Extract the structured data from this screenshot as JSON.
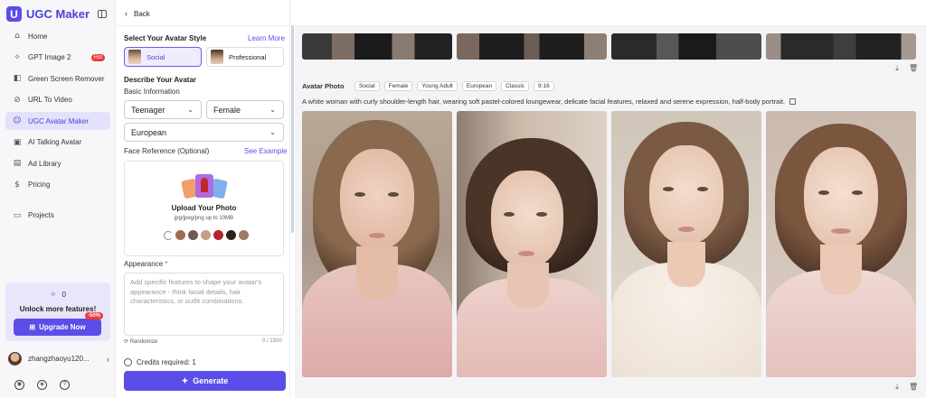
{
  "app": {
    "logo_letter": "U",
    "name": "UGC Maker"
  },
  "sidebar": {
    "items": [
      {
        "label": "Home",
        "icon": "home-icon",
        "glyph": "⌂",
        "name": "sidebar-item-home"
      },
      {
        "label": "GPT Image 2",
        "icon": "sparkle-icon",
        "glyph": "✧",
        "name": "sidebar-item-gpt-image-2",
        "badge": "Hot"
      },
      {
        "label": "Green Screen Remover",
        "icon": "layers-icon",
        "glyph": "◧",
        "name": "sidebar-item-green-screen-remover"
      },
      {
        "label": "URL To Video",
        "icon": "link-icon",
        "glyph": "⊘",
        "name": "sidebar-item-url-to-video"
      },
      {
        "label": "UGC Avatar Maker",
        "icon": "avatar-icon",
        "glyph": "☺",
        "name": "sidebar-item-ugc-avatar-maker",
        "active": true
      },
      {
        "label": "AI Talking Avatar",
        "icon": "video-icon",
        "glyph": "▣",
        "name": "sidebar-item-ai-talking-avatar"
      },
      {
        "label": "Ad Library",
        "icon": "library-icon",
        "glyph": "▤",
        "name": "sidebar-item-ad-library"
      },
      {
        "label": "Pricing",
        "icon": "dollar-icon",
        "glyph": "$",
        "name": "sidebar-item-pricing"
      },
      {
        "label": "Projects",
        "icon": "folder-icon",
        "glyph": "▭",
        "name": "sidebar-item-projects"
      }
    ],
    "credits": "0",
    "unlock_text": "Unlock more features!",
    "upgrade_label": "Upgrade Now",
    "discount": "-50%",
    "username": "zhangzhaoyu120..."
  },
  "panel": {
    "back_label": "Back",
    "style_heading": "Select Your Avatar Style",
    "learn_more": "Learn More",
    "styles": [
      "Social",
      "Professional"
    ],
    "describe_heading": "Describe Your Avatar",
    "basic_info": "Basic Information",
    "age": "Teenager",
    "gender": "Female",
    "ethnicity": "European",
    "face_ref_label": "Face Reference (Optional)",
    "see_example": "See Example",
    "upload_title": "Upload Your Photo",
    "upload_sub": "jpg/jpeg/png up to 10MB",
    "appearance_label": "Appearance",
    "required_mark": "*",
    "appearance_placeholder": "Add specific features to shape your avatar's appearance - think facial details, hair characteristics, or outfit combinations.",
    "randomize": "Randomize",
    "counter": "0 / 1500",
    "credits_required": "Credits required: 1",
    "generate_label": "Generate"
  },
  "gallery": {
    "section_title": "Avatar Photo",
    "tags": [
      "Social",
      "Female",
      "Young Adult",
      "European",
      "Classic",
      "9:16"
    ],
    "description": "A white woman with curly shoulder-length hair, wearing soft pastel-colored loungewear, delicate facial features, relaxed and serene expression, half-body portrait."
  },
  "colors": {
    "accent": "#5b4ee8",
    "hot": "#ee3b3b",
    "active_bg": "#e4e1fb"
  }
}
